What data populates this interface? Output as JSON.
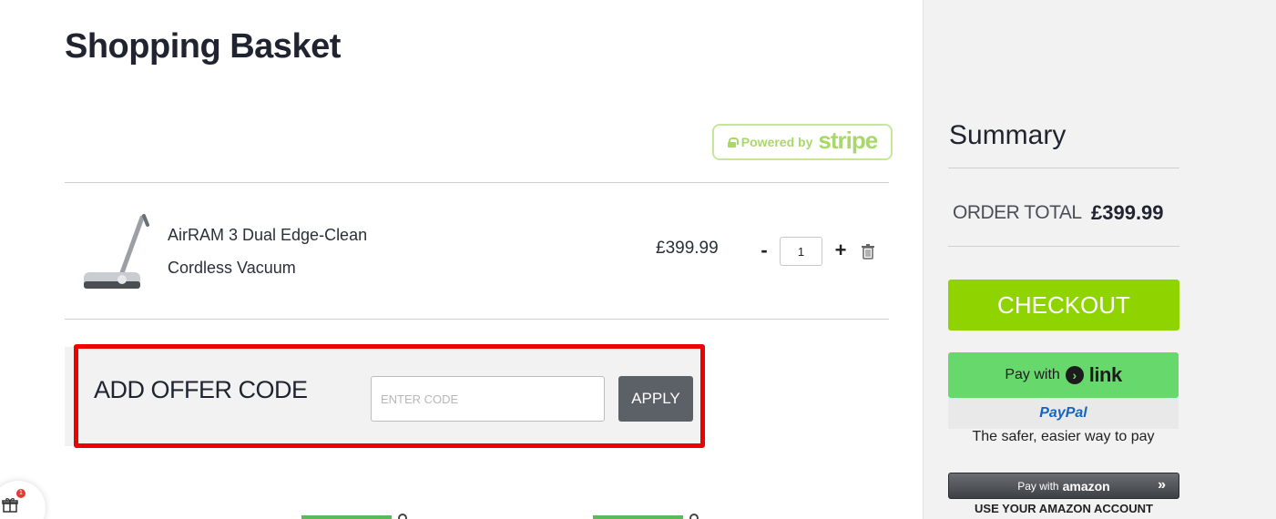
{
  "page": {
    "title": "Shopping Basket"
  },
  "stripe": {
    "powered_by": "Powered by",
    "brand": "stripe",
    "color": "#a9d86a"
  },
  "basket": {
    "items": [
      {
        "name_line1": "AirRAM 3 Dual Edge-Clean",
        "name_line2": "Cordless Vacuum",
        "price": "£399.99",
        "quantity": "1",
        "minus_label": "-",
        "plus_label": "+"
      }
    ]
  },
  "offer": {
    "title": "ADD OFFER CODE",
    "input_placeholder": "ENTER CODE",
    "apply_label": "APPLY",
    "highlight_color": "#ee0000"
  },
  "gift_widget": {
    "badge_count": "1"
  },
  "summary": {
    "title": "Summary",
    "order_total_label": "ORDER TOTAL",
    "order_total_value": "£399.99",
    "checkout_label": "CHECKOUT",
    "checkout_color": "#8fd300",
    "link_pay_with": "Pay with",
    "link_brand": "link",
    "paypal_brand": "PayPal",
    "paypal_tagline": "The safer, easier way to pay",
    "amazon_pay_with": "Pay with",
    "amazon_brand": "amazon",
    "amazon_caption": "USE YOUR AMAZON ACCOUNT"
  }
}
